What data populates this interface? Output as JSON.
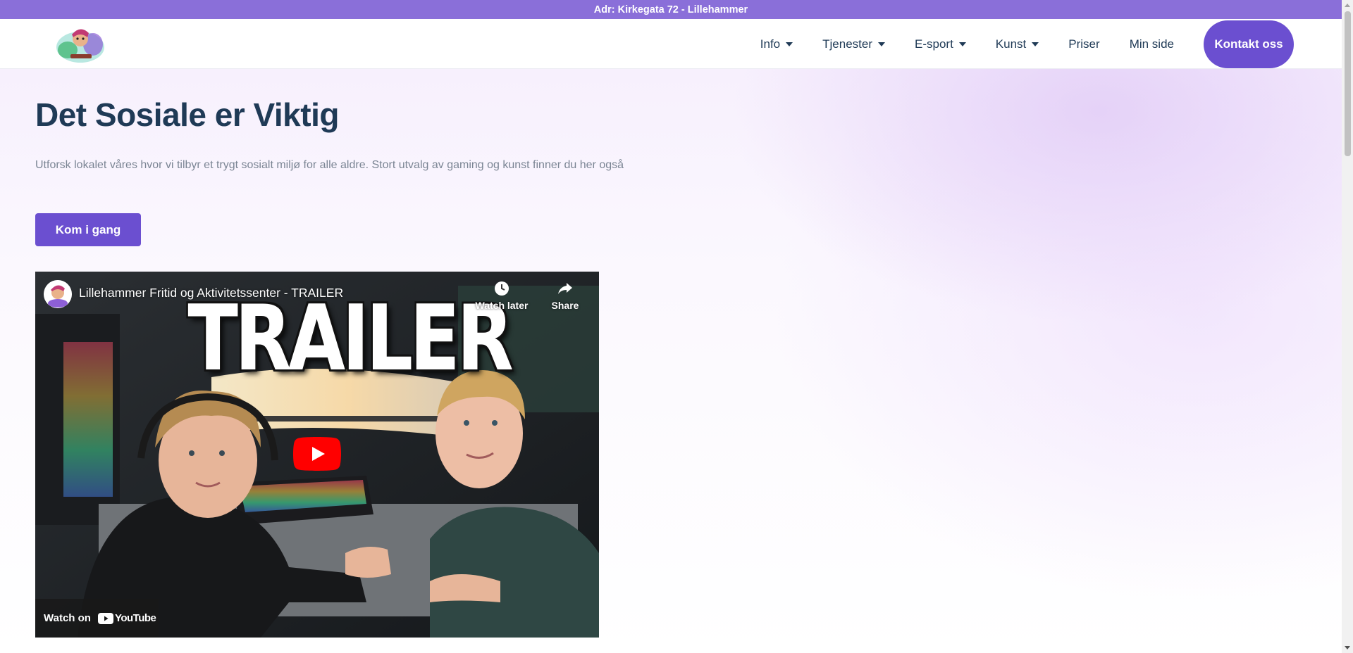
{
  "topbar": {
    "address": "Adr: Kirkegata 72 - Lillehammer"
  },
  "header": {
    "logo_name": "logo-image",
    "nav": [
      {
        "label": "Info",
        "dropdown": true
      },
      {
        "label": "Tjenester",
        "dropdown": true
      },
      {
        "label": "E-sport",
        "dropdown": true
      },
      {
        "label": "Kunst",
        "dropdown": true
      },
      {
        "label": "Priser",
        "dropdown": false
      },
      {
        "label": "Min side",
        "dropdown": false
      }
    ],
    "cta_label": "Kontakt oss"
  },
  "hero": {
    "title": "Det Sosiale er Viktig",
    "text": "Utforsk lokalet våres hvor vi tilbyr et trygt sosialt miljø for alle aldre. Stort utvalg av gaming og kunst finner du her også",
    "button_label": "Kom i gang"
  },
  "video": {
    "title": "Lillehammer Fritid og Aktivitetssenter - TRAILER",
    "thumbnail_text": "TRAILER",
    "watch_later_label": "Watch later",
    "share_label": "Share",
    "watch_on_label": "Watch on",
    "youtube_label": "YouTube"
  },
  "colors": {
    "topbar": "#8a6fd9",
    "accent": "#6b4fd0",
    "heading": "#1f3a56",
    "muted_text": "#7b8594",
    "youtube_red": "#ff0000"
  }
}
